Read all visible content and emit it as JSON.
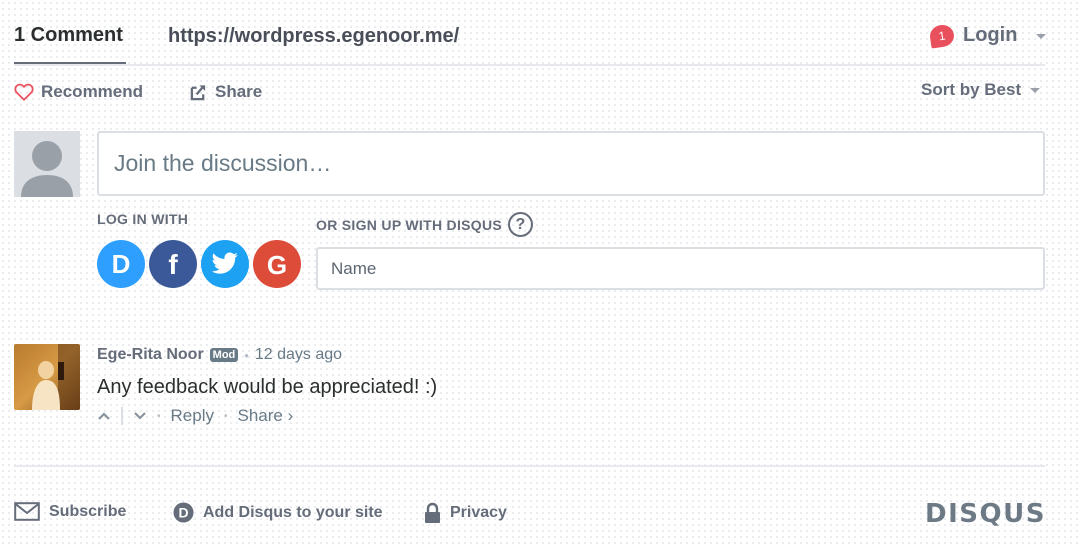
{
  "nav": {
    "comments_tab": "1 Comment",
    "site_url": "https://wordpress.egenoor.me/",
    "notification_count": "1",
    "login_label": "Login"
  },
  "actions": {
    "recommend_label": "Recommend",
    "share_label": "Share",
    "sort_label": "Sort by Best"
  },
  "composer": {
    "placeholder": "Join the discussion…",
    "login_with_label": "LOG IN WITH",
    "social_providers": [
      "Disqus",
      "Facebook",
      "Twitter",
      "Google"
    ],
    "signup_label": "OR SIGN UP WITH DISQUS",
    "help_glyph": "?",
    "name_placeholder": "Name"
  },
  "comments": [
    {
      "author": "Ege-Rita Noor",
      "badge": "Mod",
      "timestamp": "12 days ago",
      "text": "Any feedback would be appreciated! :)",
      "reply_label": "Reply",
      "share_label": "Share ›"
    }
  ],
  "footer": {
    "subscribe_label": "Subscribe",
    "add_disqus_label": "Add Disqus to your site",
    "privacy_label": "Privacy",
    "brand": "DISQUS"
  },
  "colors": {
    "text_muted": "#656c7a",
    "notification": "#e9505e",
    "disqus_blue": "#2e9fff",
    "facebook": "#3b5998",
    "twitter": "#1da1f2",
    "google": "#dd4b39",
    "heart": "#e9505e"
  },
  "icons": [
    "heart-icon",
    "share-icon",
    "chevron-down-icon",
    "user-icon",
    "help-icon",
    "chevron-up-icon",
    "envelope-icon",
    "disqus-d-icon",
    "lock-icon"
  ]
}
